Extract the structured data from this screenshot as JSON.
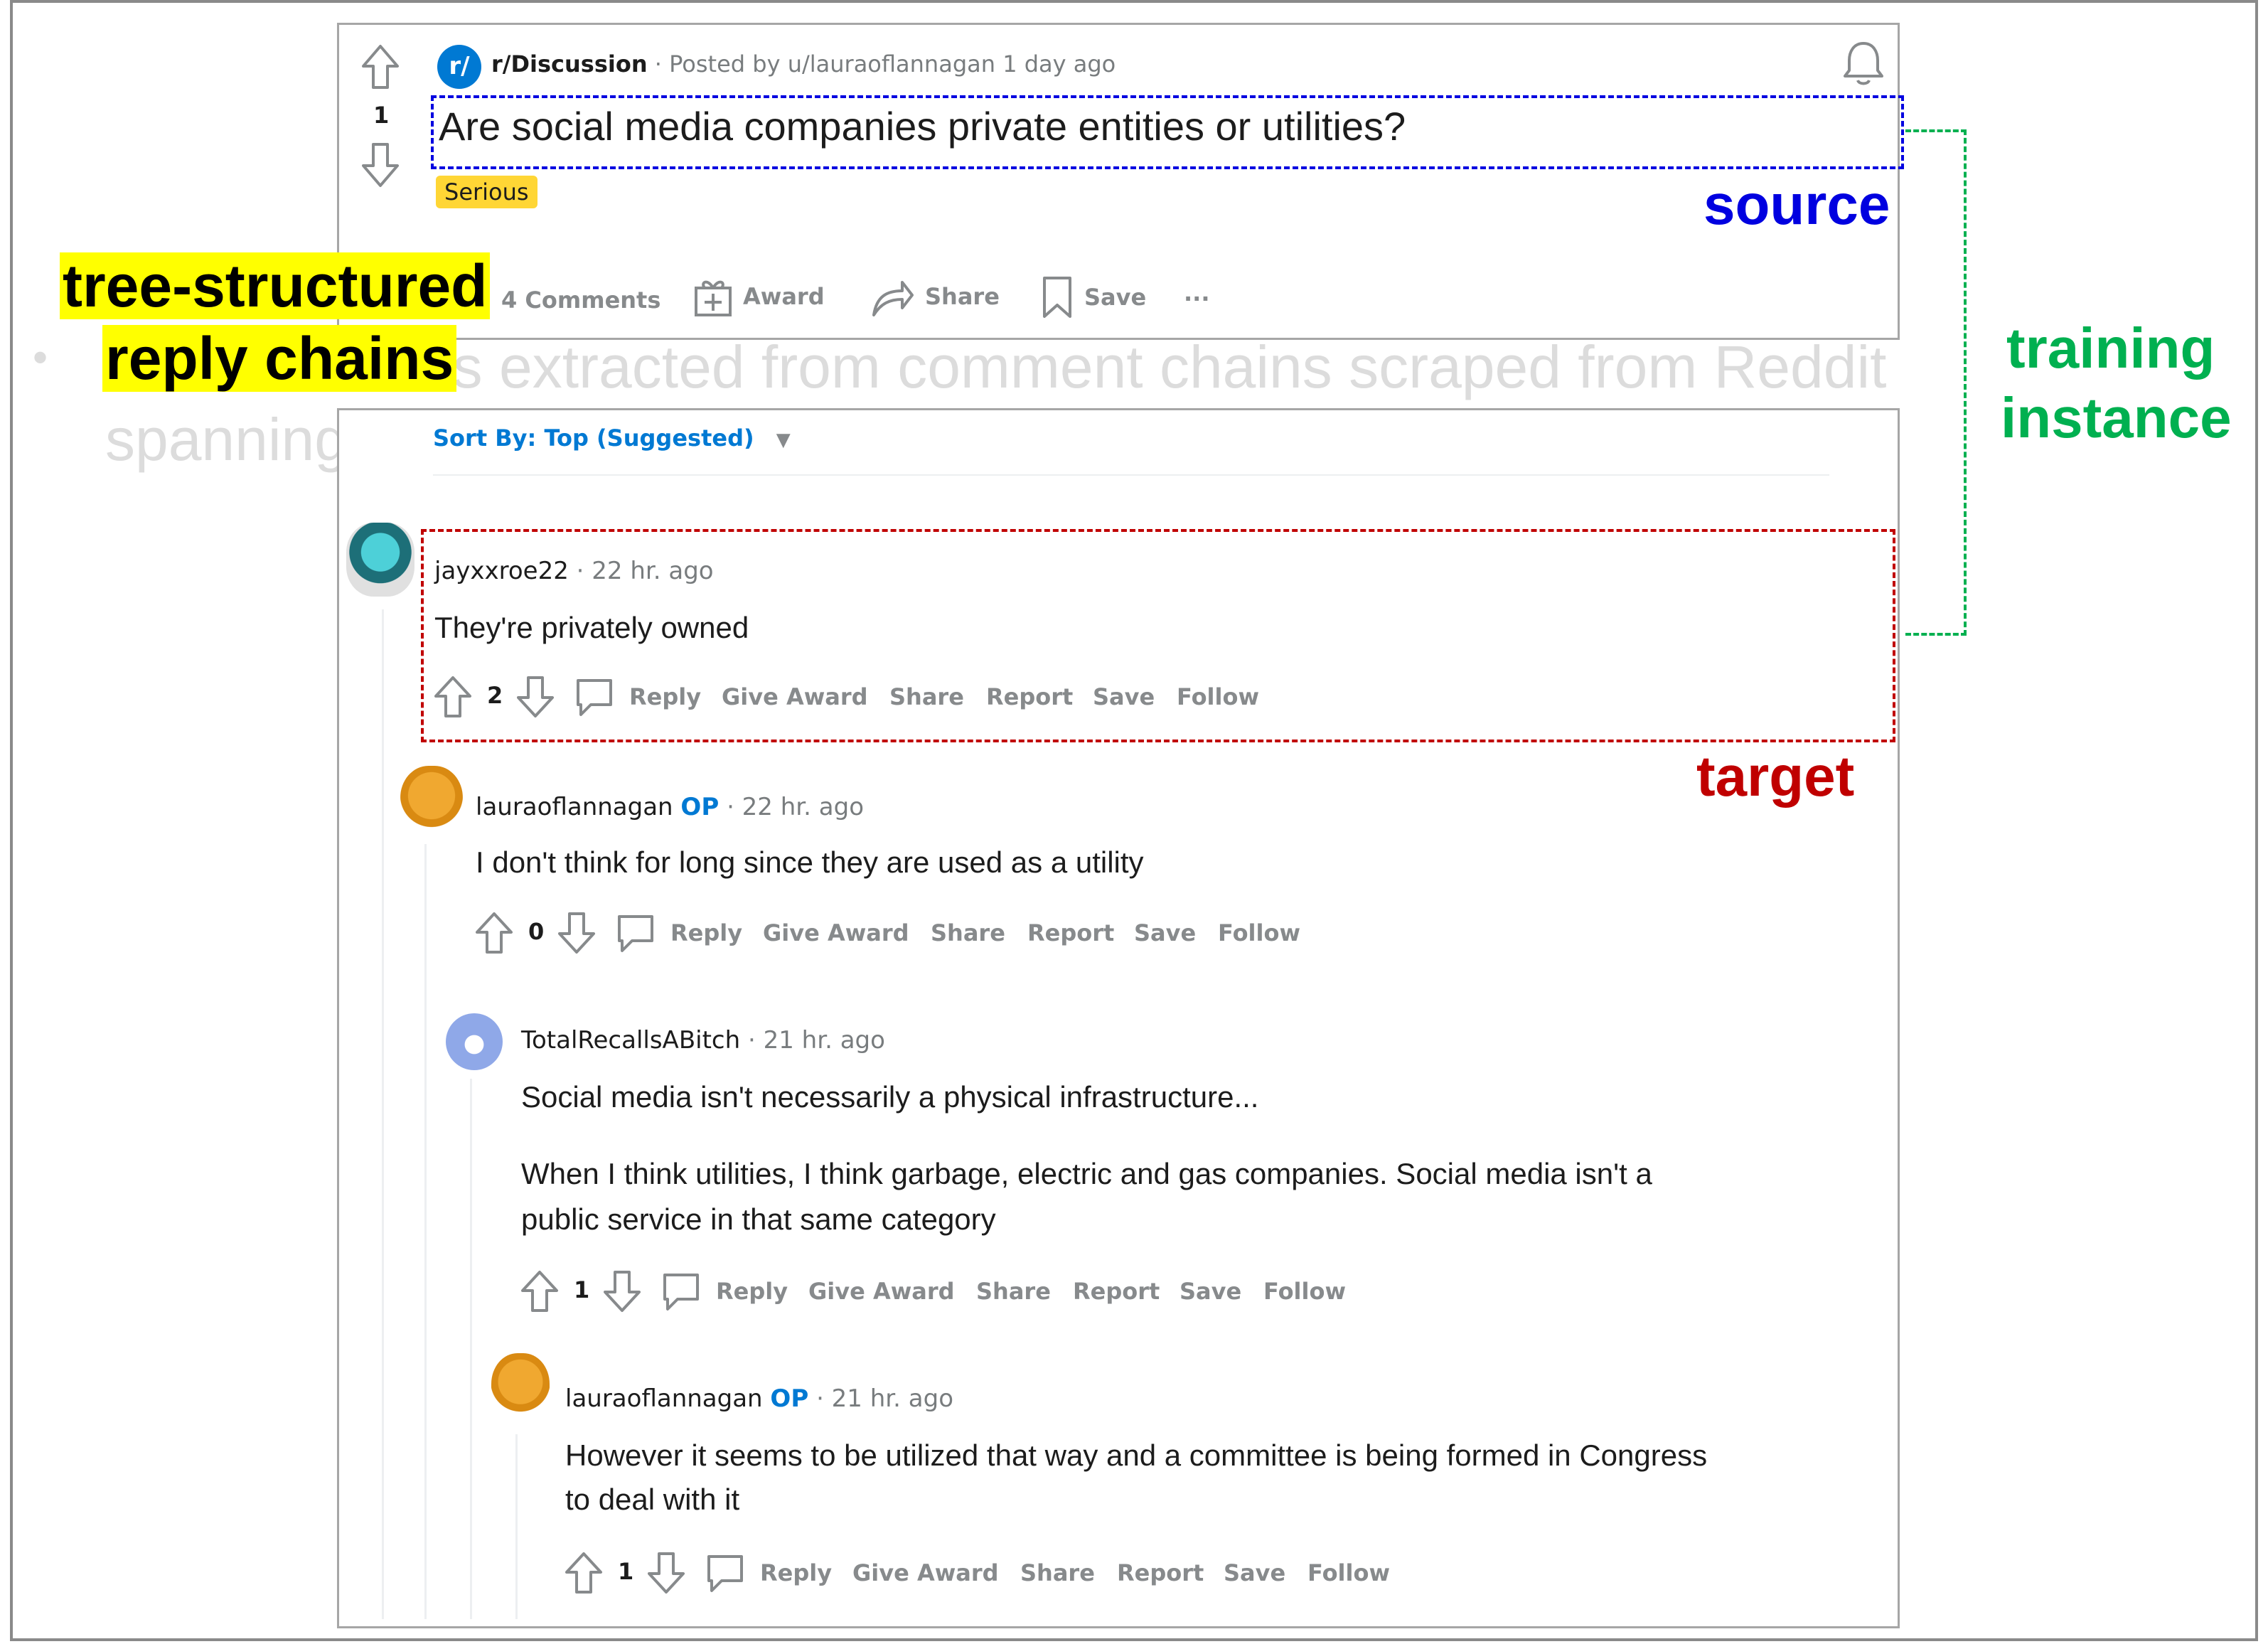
{
  "background_text": {
    "bullet": "•",
    "line1": "is extracted from comment chains scraped from Reddit",
    "line2": "spanning"
  },
  "post": {
    "subreddit": "r/Discussion",
    "subreddit_icon": "r/",
    "posted_by": "· Posted by u/lauraoflannagan 1 day ago",
    "vote_count": "1",
    "title": "Are social media companies private entities or utilities?",
    "flair": "Serious",
    "actions": {
      "comments": "4 Comments",
      "award": "Award",
      "share": "Share",
      "save": "Save",
      "more": "···"
    }
  },
  "sort": {
    "label": "Sort By: Top (Suggested)"
  },
  "comments": [
    {
      "username": "jayxxroe22",
      "op": "",
      "time": "· 22 hr. ago",
      "lines": [
        "They're privately owned"
      ],
      "votes": "2"
    },
    {
      "username": "lauraoflannagan",
      "op": "OP",
      "time": "· 22 hr. ago",
      "lines": [
        "I don't think for long since they are used as a utility"
      ],
      "votes": "0"
    },
    {
      "username": "TotalRecallsABitch",
      "op": "",
      "time": "· 21 hr. ago",
      "lines": [
        "Social media isn't necessarily a physical infrastructure...",
        "When I think utilities, I think garbage, electric and gas companies. Social media isn't a",
        "public service in that same category"
      ],
      "votes": "1"
    },
    {
      "username": "lauraoflannagan",
      "op": "OP",
      "time": "· 21 hr. ago",
      "lines": [
        "However it seems to be utilized that way and a committee is being formed in Congress",
        "to deal with it"
      ],
      "votes": "1"
    }
  ],
  "comment_actions": {
    "reply": "Reply",
    "give_award": "Give Award",
    "share": "Share",
    "report": "Report",
    "save": "Save",
    "follow": "Follow"
  },
  "annotations": {
    "source": "source",
    "target": "target",
    "training_line1": "training",
    "training_line2": "instance",
    "tree_line1": "tree-structured",
    "tree_line2": "reply chains"
  },
  "colors": {
    "source": "#0000e0",
    "target": "#c00000",
    "training": "#00b050",
    "highlight": "#ffff00",
    "reddit_blue": "#0079d3",
    "flair": "#ffd635"
  }
}
